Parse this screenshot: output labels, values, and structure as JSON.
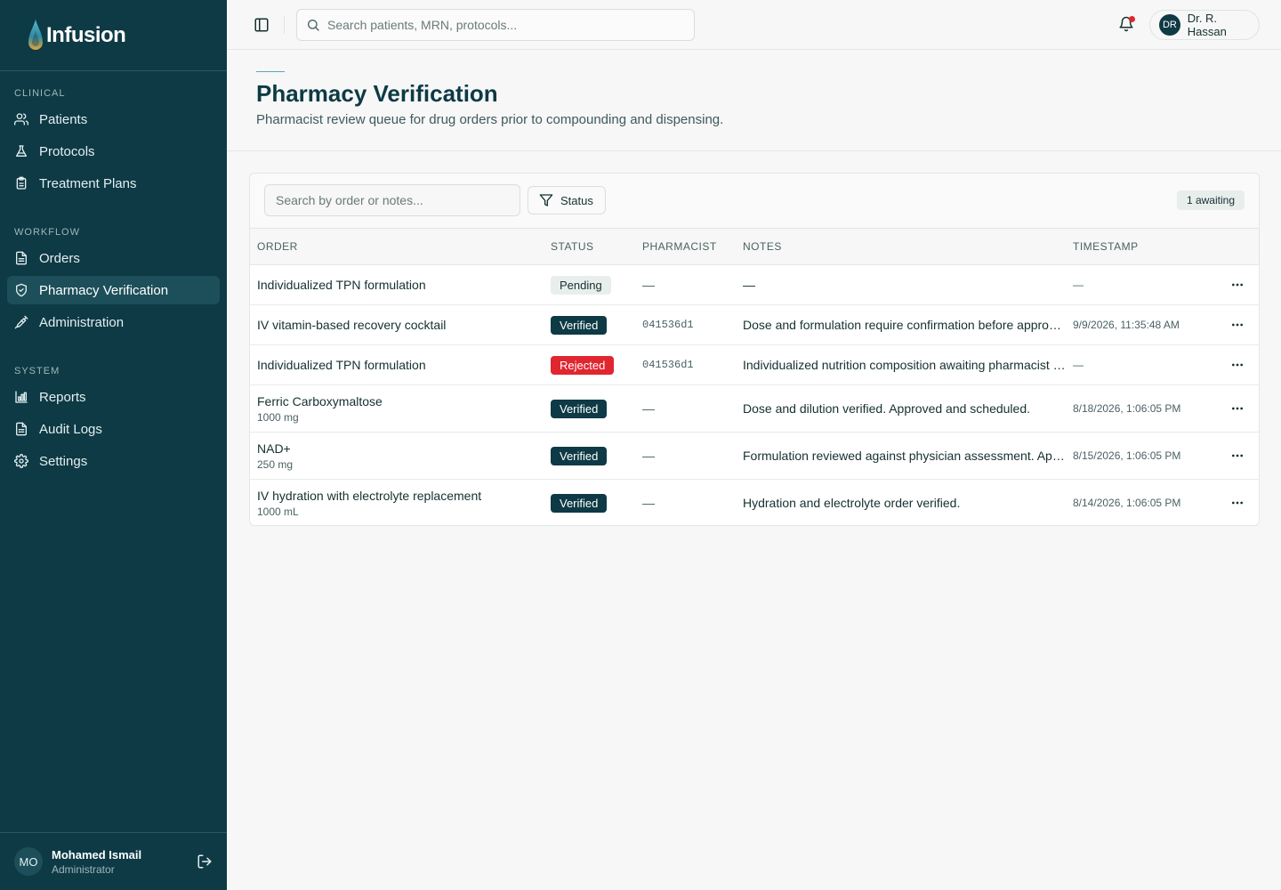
{
  "brand": {
    "name": "Infusion"
  },
  "sidebar": {
    "sections": [
      {
        "label": "CLINICAL",
        "items": [
          {
            "label": "Patients",
            "icon": "users-icon"
          },
          {
            "label": "Protocols",
            "icon": "flask-icon"
          },
          {
            "label": "Treatment Plans",
            "icon": "clipboard-icon"
          }
        ]
      },
      {
        "label": "WORKFLOW",
        "items": [
          {
            "label": "Orders",
            "icon": "file-icon"
          },
          {
            "label": "Pharmacy Verification",
            "icon": "shield-check-icon",
            "active": true
          },
          {
            "label": "Administration",
            "icon": "syringe-icon"
          }
        ]
      },
      {
        "label": "SYSTEM",
        "items": [
          {
            "label": "Reports",
            "icon": "bar-chart-icon"
          },
          {
            "label": "Audit Logs",
            "icon": "logs-icon"
          },
          {
            "label": "Settings",
            "icon": "gear-icon"
          }
        ]
      }
    ],
    "user": {
      "initials": "MO",
      "name": "Mohamed Ismail",
      "role": "Administrator"
    }
  },
  "topbar": {
    "search_placeholder": "Search patients, MRN, protocols...",
    "user": {
      "initials": "DR",
      "name": "Dr. R. Hassan"
    }
  },
  "page": {
    "title": "Pharmacy Verification",
    "subtitle": "Pharmacist review queue for drug orders prior to compounding and dispensing."
  },
  "toolbar": {
    "filter_placeholder": "Search by order or notes...",
    "status_label": "Status",
    "awaiting_label": "1 awaiting"
  },
  "table": {
    "columns": [
      "ORDER",
      "STATUS",
      "PHARMACIST",
      "NOTES",
      "TIMESTAMP"
    ],
    "rows": [
      {
        "order": "Individualized TPN formulation",
        "dose": "",
        "status": "Pending",
        "status_kind": "pending",
        "pharmacist": "—",
        "notes": "—",
        "timestamp": "—"
      },
      {
        "order": "IV vitamin-based recovery cocktail",
        "dose": "",
        "status": "Verified",
        "status_kind": "verified",
        "pharmacist": "041536d1",
        "notes": "Dose and formulation require confirmation before approval.",
        "timestamp": "9/9/2026, 11:35:48 AM"
      },
      {
        "order": "Individualized TPN formulation",
        "dose": "",
        "status": "Rejected",
        "status_kind": "rejected",
        "pharmacist": "041536d1",
        "notes": "Individualized nutrition composition awaiting pharmacist review.",
        "timestamp": "—"
      },
      {
        "order": "Ferric Carboxymaltose",
        "dose": "1000 mg",
        "status": "Verified",
        "status_kind": "verified",
        "pharmacist": "—",
        "notes": "Dose and dilution verified. Approved and scheduled.",
        "timestamp": "8/18/2026, 1:06:05 PM"
      },
      {
        "order": "NAD+",
        "dose": "250 mg",
        "status": "Verified",
        "status_kind": "verified",
        "pharmacist": "—",
        "notes": "Formulation reviewed against physician assessment. Approved.",
        "timestamp": "8/15/2026, 1:06:05 PM"
      },
      {
        "order": "IV hydration with electrolyte replacement",
        "dose": "1000 mL",
        "status": "Verified",
        "status_kind": "verified",
        "pharmacist": "—",
        "notes": "Hydration and electrolyte order verified.",
        "timestamp": "8/14/2026, 1:06:05 PM"
      }
    ]
  },
  "colors": {
    "sidebar_bg": "#0d3a45",
    "sidebar_active": "#1d4f5a",
    "verified": "#0d3a45",
    "rejected": "#e0262f",
    "pending": "#e8eeec",
    "notification_dot": "#e0262f"
  }
}
